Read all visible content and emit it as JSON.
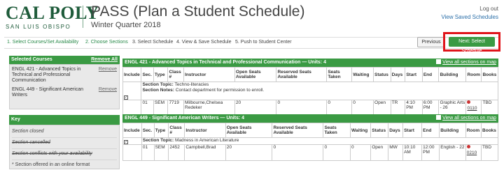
{
  "header": {
    "logo_main": "CAL POLY",
    "logo_sub": "SAN LUIS OBISPO",
    "app_title": "PASS (Plan a Student Schedule)",
    "term": "Winter Quarter 2018",
    "logout": "Log out",
    "view_saved": "View Saved Schedules"
  },
  "steps": [
    {
      "label": "1. Select Courses/Set Availability"
    },
    {
      "label": "2. Choose Sections"
    },
    {
      "label": "3. Select Schedule"
    },
    {
      "label": "4. View & Save Schedule"
    },
    {
      "label": "5. Push to Student Center"
    }
  ],
  "buttons": {
    "previous": "Previous",
    "next": "Next: Select Schedule"
  },
  "sidebar": {
    "selected_title": "Selected Courses",
    "remove_all": "Remove All",
    "courses": [
      {
        "name": "ENGL 421 - Advanced Topics in Technical and Professional Communication",
        "remove": "Remove"
      },
      {
        "name": "ENGL 449 - Significant American Writers",
        "remove": "Remove"
      }
    ],
    "key_title": "Key",
    "key_items": [
      {
        "label": "Section closed"
      },
      {
        "label": "Section cancelled"
      },
      {
        "label": "Section conflicts with your availability"
      },
      {
        "label": "* Section offered in an online format"
      }
    ]
  },
  "courses": [
    {
      "title": "ENGL 421 - Advanced Topics in Technical and Professional Communication — Units: 4",
      "map_link": "View all sections on map",
      "headers": [
        "Include",
        "Sec.",
        "Type",
        "Class #",
        "Instructor",
        "Open Seats Available",
        "Reserved Seats Available",
        "Seats Taken",
        "Waiting",
        "Status",
        "Days",
        "Start",
        "End",
        "Building",
        "Room",
        "Books"
      ],
      "topic_label": "Section Topic:",
      "topic": "Techno-literacies",
      "notes_label": "Section Notes:",
      "notes": "Contact department for permission to enroll.",
      "row": {
        "sec": "01",
        "type": "SEM",
        "class": "7719",
        "instructor": "Milbourne,Chelsea Redeker",
        "open": "20",
        "reserved": "0",
        "taken": "0",
        "waiting": "0",
        "status": "Open",
        "days": "TR",
        "start": "4:10 PM",
        "end": "6:00 PM",
        "building": "Graphic Arts - 26",
        "room": "0110",
        "books": "TBD"
      }
    },
    {
      "title": "ENGL 449 - Significant American Writers — Units: 4",
      "map_link": "View all sections on map",
      "headers": [
        "Include",
        "Sec.",
        "Type",
        "Class #",
        "Instructor",
        "Open Seats Available",
        "Reserved Seats Available",
        "Seats Taken",
        "Waiting",
        "Status",
        "Days",
        "Start",
        "End",
        "Building",
        "Room",
        "Books"
      ],
      "topic_label": "Section Topic:",
      "topic": "Madness in American Literature",
      "row": {
        "sec": "01",
        "type": "SEM",
        "class": "2452",
        "instructor": "Campbell,Brad",
        "open": "20",
        "reserved": "0",
        "taken": "0",
        "waiting": "0",
        "status": "Open",
        "days": "MW",
        "start": "10:10 AM",
        "end": "12:00 PM",
        "building": "English - 22",
        "room": "0210",
        "books": "TBD"
      }
    }
  ]
}
